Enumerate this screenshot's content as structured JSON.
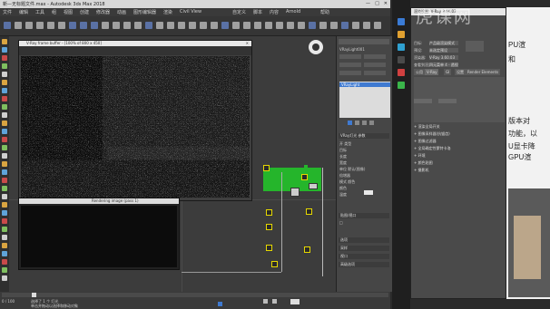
{
  "window": {
    "title": "新—无标题文件.max - Autodesk 3ds Max 2018"
  },
  "menubar": {
    "items": [
      "文件",
      "编辑",
      "工具",
      "组",
      "视图",
      "创建",
      "修改器",
      "动画",
      "图形编辑器",
      "渲染",
      "Civil View",
      "自定义",
      "脚本",
      "内容",
      "Arnold",
      "帮助"
    ]
  },
  "frame_buffer": {
    "title": "V-Ray frame buffer - [100% of 800 x 450]",
    "second_title": "Rendering image (pass 1)"
  },
  "command_panel": {
    "object_name": "VRayLight001",
    "stack_item": "VRayLight",
    "section_general": "VRay灯光 参数",
    "rows": [
      "开  类型",
      "目标",
      "长度",
      "宽度",
      "单位  默认(图像)",
      "倍增器",
      "模式  颜色",
      "颜色",
      "温度"
    ],
    "rollups": [
      "选项",
      "采样",
      "视口",
      "高级选项"
    ],
    "mid_rollup": "贴图/视口"
  },
  "render_setup": {
    "title": "渲染设置: V-Ray 3.60.03",
    "target_label": "目标:",
    "target_value": "产品级渲染模式",
    "preset_label": "预设:",
    "preset_value": "未选定预设",
    "renderer_label": "渲染器:",
    "renderer_value": "V-Ray 3.60.03",
    "view_label": "查看到渲染:",
    "view_value": "四元菜单 4 - 透视",
    "tabs": [
      "公用",
      "V-Ray",
      "GI",
      "设置",
      "Render Elements"
    ],
    "sections": [
      "渲染全局开关",
      "图像采样器(抗锯齿)",
      "图像过滤器",
      "全局确定性蒙特卡洛",
      "环境",
      "颜色贴图",
      "摄影机"
    ]
  },
  "side_doc": {
    "lines": [
      "PU渲",
      "和",
      "版本对",
      "功能，以",
      "U显卡降",
      "GPU渲"
    ]
  },
  "watermark": {
    "text": "虎课网"
  },
  "statusbar": {
    "frame": "0 / 100",
    "selected": "选择了 1 个 灯光",
    "hint": "单击并拖动以选择和移动对象"
  }
}
